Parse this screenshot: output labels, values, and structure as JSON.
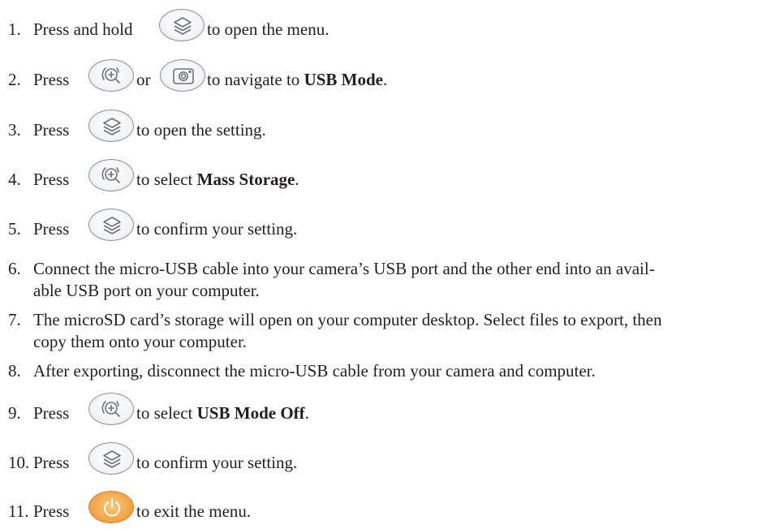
{
  "steps": [
    {
      "num": "1.",
      "before": "Press and hold",
      "icon": "layers-icon",
      "after": "to open the menu."
    },
    {
      "num": "2.",
      "before": "Press",
      "icon": "zoom-icon",
      "middle": "or",
      "icon2": "camera-icon",
      "after": "to navigate to",
      "bold": "USB Mode",
      "end": "."
    },
    {
      "num": "3.",
      "before": "Press",
      "icon": "layers-icon",
      "after": "to open the setting."
    },
    {
      "num": "4.",
      "before": "Press",
      "icon": "zoom-icon",
      "after": "to select",
      "bold": "Mass Storage",
      "end": "."
    },
    {
      "num": "5.",
      "before": "Press",
      "icon": "layers-icon",
      "after": "to confirm your setting."
    },
    {
      "num": "6.",
      "line1": "Connect the micro-USB cable into your camera’s USB port and the other end into an avail-",
      "line2": "able USB port on your computer."
    },
    {
      "num": "7.",
      "line1": "The microSD card’s storage will open on your computer desktop. Select files to export, then",
      "line2": "copy them onto your computer."
    },
    {
      "num": "8.",
      "line1": "After exporting, disconnect the micro-USB cable from your camera and computer."
    },
    {
      "num": "9.",
      "before": "Press",
      "icon": "zoom-icon",
      "after": "to select",
      "bold": "USB Mode Off",
      "end": "."
    },
    {
      "num": "10.",
      "before": "Press",
      "icon": "layers-icon",
      "after": "to confirm your setting."
    },
    {
      "num": "11.",
      "before": "Press",
      "icon": "power-icon",
      "after": "to exit the menu."
    }
  ],
  "colors": {
    "text": "#231f20",
    "button_gray": "#8e9196",
    "power_orange": "#f3a649"
  }
}
